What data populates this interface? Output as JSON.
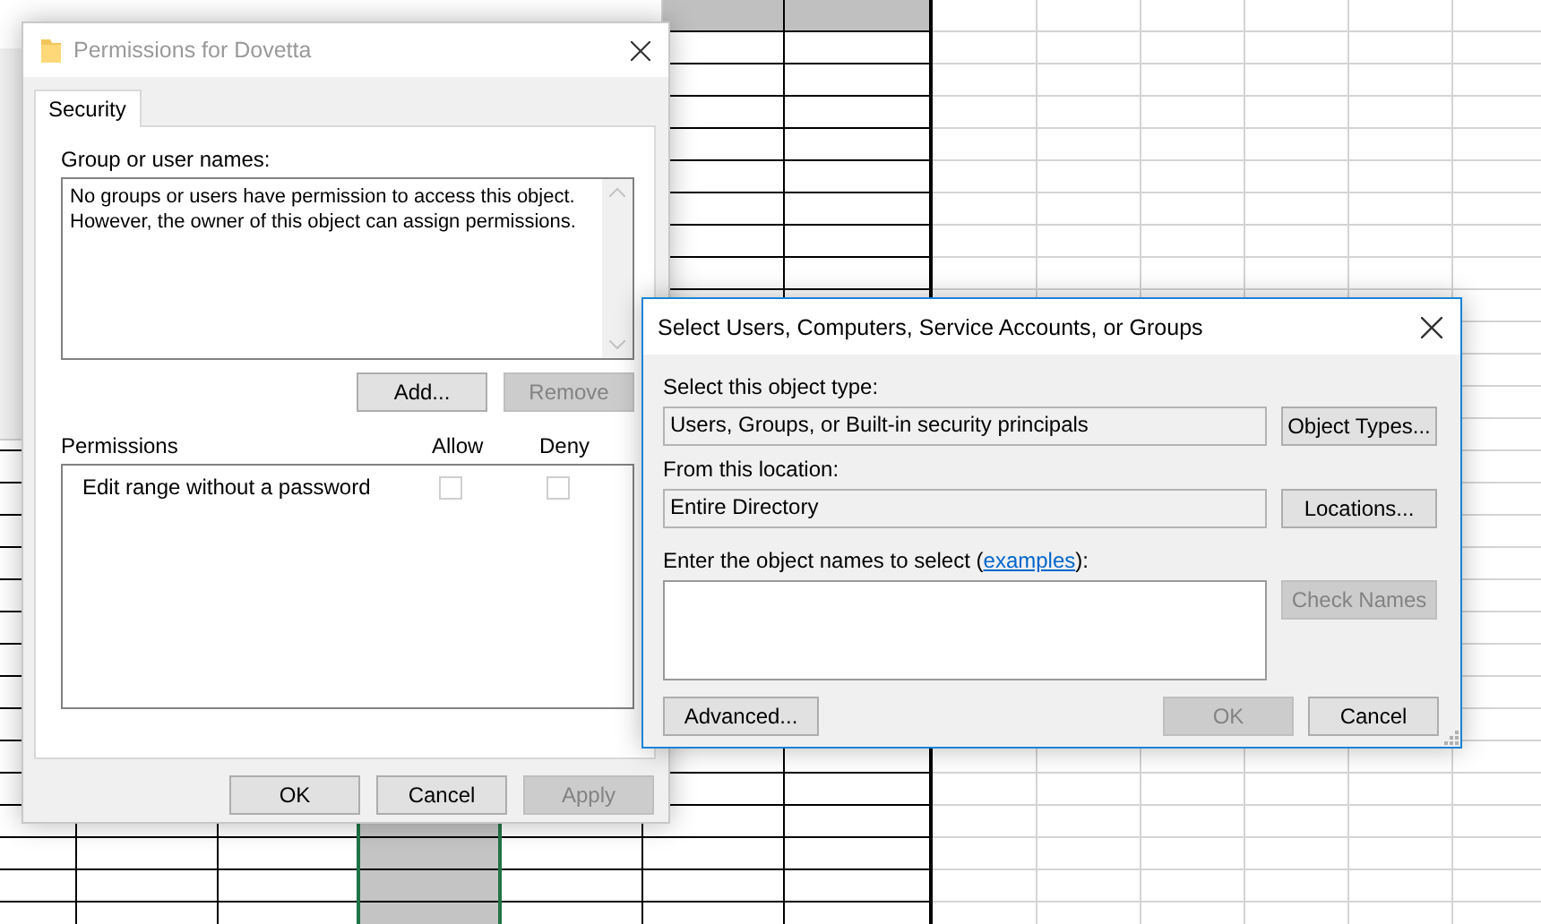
{
  "background_dialog": {
    "kind": "window"
  },
  "permissions_dialog": {
    "title": "Permissions for Dovetta",
    "tabs": [
      {
        "label": "Security",
        "selected": true
      }
    ],
    "group_label": "Group or user names:",
    "group_message": [
      "No groups or users have permission to access this object.",
      "However, the owner of this object can assign permissions."
    ],
    "group_buttons": [
      {
        "label": "Add...",
        "disabled": false
      },
      {
        "label": "Remove",
        "disabled": true
      }
    ],
    "permission_columns": [
      "Permissions",
      "Allow",
      "Deny"
    ],
    "permissions": [
      {
        "name": "Edit range without a password",
        "allow": false,
        "deny": false
      }
    ],
    "footer_buttons": [
      {
        "label": "OK",
        "disabled": false
      },
      {
        "label": "Cancel",
        "disabled": false
      },
      {
        "label": "Apply",
        "disabled": true
      }
    ]
  },
  "select_dialog": {
    "title": "Select Users, Computers, Service Accounts, or Groups",
    "object_type_label": "Select this object type:",
    "object_type": "Users, Groups, or Built-in security principals",
    "object_type_button": {
      "label": "Object Types...",
      "disabled": false
    },
    "location_label": "From this location:",
    "location": "Entire Directory",
    "location_button": {
      "label": "Locations...",
      "disabled": false
    },
    "names_label": {
      "before": "Enter the object names to select (",
      "link": "examples",
      "after": "):"
    },
    "check_button": {
      "label": "Check Names",
      "disabled": true
    },
    "footer_left": {
      "label": "Advanced...",
      "disabled": false
    },
    "footer_buttons": [
      {
        "label": "OK",
        "disabled": true
      },
      {
        "label": "Cancel",
        "disabled": false
      }
    ]
  }
}
